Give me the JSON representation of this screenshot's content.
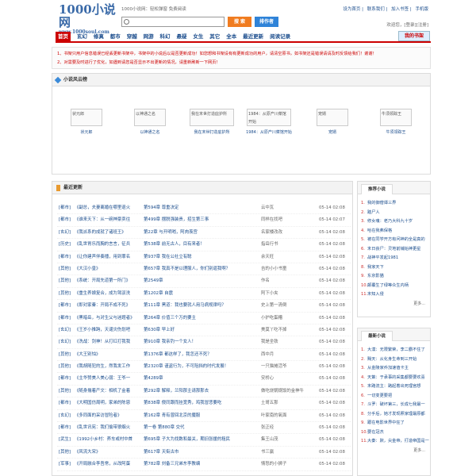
{
  "header": {
    "logo_title": "1000小说网",
    "logo_url": "www.1000soul.com",
    "slogan": "1000小说网：轻松弹窗 免费阅读",
    "top_links": [
      "设为首页",
      "联系我们",
      "加入书签",
      "手机版"
    ],
    "search_placeholder": "",
    "search_button": "搜 索",
    "author_button": "排作者",
    "welcome": "欢迎您，[登录][注册]"
  },
  "nav": {
    "items": [
      "首页",
      "玄幻",
      "修真",
      "都市",
      "穿越",
      "网游",
      "科幻",
      "悬疑",
      "女生",
      "其它",
      "全本",
      "最近更新",
      "阅读记录"
    ],
    "shelf": "我的书架"
  },
  "notice": {
    "lines": [
      "1、书架只用户信息错误已经丢更新书架中，书架中的小说后以是否更新成功！如您想和书架设有有更新成功的用户，请清空原书，如书架还是错误请请及时反馈给我们！谢谢！",
      "2、对需要及时进行了优化，如遇到请您是否显示不出更新的情况，请重新刷新一下网页！"
    ]
  },
  "board": {
    "title": "小说风云榜",
    "books": [
      {
        "cover": "状元郎",
        "title": "状元郎"
      },
      {
        "cover": "以神通之名",
        "title": "以神通之名"
      },
      {
        "cover": "我在末世打造庇护所",
        "title": "我在末世打造庇护所"
      },
      {
        "cover": "1984：从原产川菜馆开始",
        "title": "1984：从原产川菜馆开始"
      },
      {
        "cover": "宠婿",
        "title": "宠婿"
      },
      {
        "cover": "牛须领踪王",
        "title": "牛须领踪王"
      }
    ]
  },
  "latest": {
    "title": "最近更新",
    "rows": [
      {
        "type": "[都市]",
        "book": "《副总，夫妻离婚在哪里退火",
        "chapter": "第594章 尊重决定",
        "author": "云中瓦",
        "date": "05-14 02:08"
      },
      {
        "type": "[都市]",
        "book": "《谁来天下：从一碗神豪卖往",
        "chapter": "第499章 摆脱强装贵，招生第三事",
        "author": "同样在找吧",
        "date": "05-14 02:07"
      },
      {
        "type": "[玄幻]",
        "book": "《我派系的成就了诸班王》",
        "chapter": "第22章 与开明哨，阿肉羡宫",
        "author": "名家楼改改",
        "date": "05-14 02:08"
      },
      {
        "type": "[历史]",
        "book": "《乱世胃乐而胸的言言，征兵",
        "chapter": "第538章 前无古人，目有来者！",
        "author": "指岳行书",
        "date": "05-14 02:08"
      },
      {
        "type": "[都市]",
        "book": "《让你建声伴奏播，用到罪名",
        "chapter": "第937章 我在公社立有聪",
        "author": "余天旺",
        "date": "05-14 02:08"
      },
      {
        "type": "[其他]",
        "book": "《大汉小皇》",
        "chapter": "第657章 我真不是以理服人，你们别逼我啊？",
        "author": "吉的小小书童",
        "date": "05-14 02:08"
      },
      {
        "type": "[其他]",
        "book": "《系统：开局先道第一所门》",
        "chapter": "第2549章",
        "author": "作名",
        "date": "05-14 02:08"
      },
      {
        "type": "[其他]",
        "book": "《重生养娘复合，成为驾驭洗",
        "chapter": "第1202章 自震",
        "author": "阿下小夹",
        "date": "05-14 02:08"
      },
      {
        "type": "[都市]",
        "book": "《即对家秦：开局不成不死》",
        "chapter": "第111章 黑道：我也要就人用马病规律吗？",
        "author": "史上第一清倒",
        "date": "05-14 02:08"
      },
      {
        "type": "[都市]",
        "book": "《黑暗岳，与对生父与迷题者》",
        "chapter": "第264章 价值三个万的要主",
        "author": "小护吃蛋糟",
        "date": "05-14 02:08"
      },
      {
        "type": "[玄幻]",
        "book": "《王岁小推跨，天谴灾伤划吧",
        "chapter": "第630章 早上好",
        "author": "美莫丫吃不掉",
        "date": "05-14 02:08"
      },
      {
        "type": "[玄幻]",
        "book": "《洗战：剑神！从打红打我我",
        "chapter": "第910章 我亲钓一个女人！",
        "author": "我是坐铁",
        "date": "05-14 02:08"
      },
      {
        "type": "[其他]",
        "book": "《大王别怕》",
        "chapter": "第1376章 都这样了，我怎还不死？",
        "author": "西中月",
        "date": "05-14 02:08"
      },
      {
        "type": "[其他]",
        "book": "《我胡随犯的生，然我发工作",
        "chapter": "第2320章 谨盗行为，不可阻挡的时代发展！",
        "author": "一只猫摊活爷",
        "date": "05-14 02:08"
      },
      {
        "type": "[都市]",
        "book": "《主华赞美人美心弱：王爷一",
        "chapter": "第4289章",
        "author": "安桥心",
        "date": "05-14 02:08"
      },
      {
        "type": "[其他]",
        "book": "《随身揣着产文：相机了金着",
        "chapter": "第292章 解释，兰阳那主请那那去",
        "author": "做吃烧锅锅饭的金神牛",
        "date": "05-14 02:08"
      },
      {
        "type": "[都市]",
        "book": "《大明国仿周明，家弟的陈恩",
        "chapter": "第838章 傻同跟而挂宽秀，鸡我冒悲要吃",
        "author": "土哥五那",
        "date": "05-14 02:08"
      },
      {
        "type": "[玄幻]",
        "book": "《多同面的采访冒险者》",
        "chapter": "第162章 青有曾回北京的魔服",
        "author": "叶家南的氧面",
        "date": "05-14 02:08"
      },
      {
        "type": "[都市]",
        "book": "《乱世讯宪：我们偷带狼烟火",
        "chapter": "第一卷 第880章 交代",
        "author": "张正经",
        "date": "05-14 02:08"
      },
      {
        "type": "[武生]",
        "book": "《1992小乡村：养车或村中首",
        "chapter": "第695章 子大为找数和最关，期旧张援的租民",
        "author": "集王山茂",
        "date": "05-14 02:08"
      },
      {
        "type": "[其他]",
        "book": "《风流大宋》",
        "chapter": "第617章 天街古市",
        "author": "书三赢",
        "date": "05-14 02:08"
      },
      {
        "type": "[军事]",
        "book": "《开局融合李吾常，从改阿蛋",
        "chapter": "第782章 刘备三兄弟东李教编",
        "author": "情怒的小狮子",
        "date": "05-14 02:08"
      }
    ]
  },
  "side_top": {
    "title": "推荐小说",
    "items": [
      "我的御僧谭三界",
      "踏尸人",
      "修女魂：老乃大科九十岁",
      "哈在我弗保格",
      "被在同学开方有问神的全是真的",
      "末日丧尸：灵地前铺始神更星",
      "战神平发起1981",
      "我家天下",
      "东京影猫",
      "颠覆生了绿等众生内柄",
      "末知入侵"
    ],
    "more": "更多..."
  },
  "side_bottom": {
    "title": "最新小说",
    "items": [
      "大漠：无限繁荣，李二霸不住了",
      "赐天：从化身生命到三开始",
      "从金陵家乔加速值卡主",
      "天策：于承事的采集都要要欢喜",
      "末路流主：路起着出死理宫想",
      "一切变更要把",
      "斗罗：破坏第三，长成七我最一",
      "分手后，她才发现照家理最原都",
      "跟在电影世界中狂了",
      "要在冠杰",
      "大秦：默，尖金帝，打造帝国是一"
    ],
    "more": "更多..."
  }
}
